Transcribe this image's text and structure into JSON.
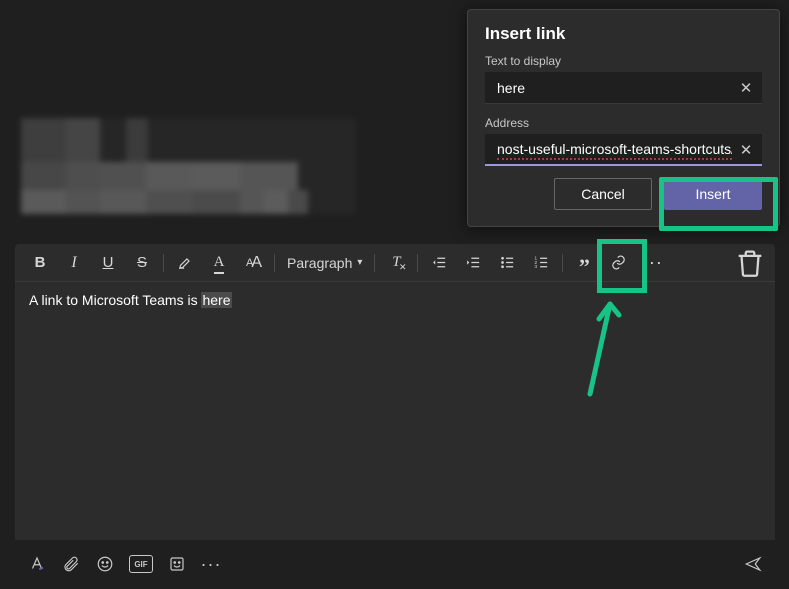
{
  "dialog": {
    "title": "Insert link",
    "text_label": "Text to display",
    "text_value": "here",
    "address_label": "Address",
    "address_value": "nost-useful-microsoft-teams-shortcuts/",
    "cancel": "Cancel",
    "insert": "Insert"
  },
  "toolbar": {
    "paragraph_label": "Paragraph"
  },
  "editor": {
    "prefix": "A link to Microsoft Teams is ",
    "selected": "here"
  },
  "bottom": {
    "gif_label": "GIF"
  },
  "colors": {
    "accent": "#6264a7",
    "highlight": "#17c387"
  }
}
